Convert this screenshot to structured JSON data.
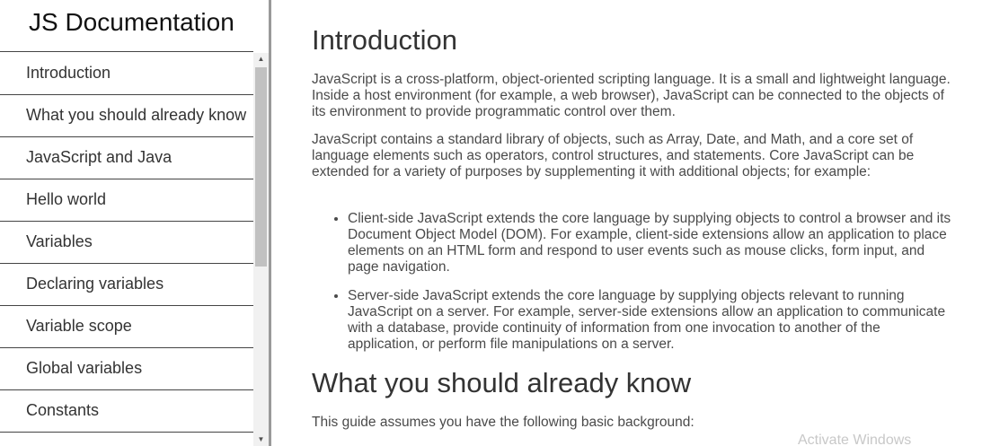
{
  "sidebar": {
    "title": "JS Documentation",
    "items": [
      {
        "label": "Introduction"
      },
      {
        "label": "What you should already know"
      },
      {
        "label": "JavaScript and Java"
      },
      {
        "label": "Hello world"
      },
      {
        "label": "Variables"
      },
      {
        "label": "Declaring variables"
      },
      {
        "label": "Variable scope"
      },
      {
        "label": "Global variables"
      },
      {
        "label": "Constants"
      }
    ]
  },
  "scrollbar": {
    "up_icon": "chevron-up-icon",
    "down_icon": "chevron-down-icon"
  },
  "main": {
    "introduction": {
      "title": "Introduction",
      "paragraphs": [
        "JavaScript is a cross-platform, object-oriented scripting language. It is a small and lightweight language. Inside a host environment (for example, a web browser), JavaScript can be connected to the objects of its environment to provide programmatic control over them.",
        "JavaScript contains a standard library of objects, such as Array, Date, and Math, and a core set of language elements such as operators, control structures, and statements. Core JavaScript can be extended for a variety of purposes by supplementing it with additional objects; for example:"
      ],
      "list": [
        "Client-side JavaScript extends the core language by supplying objects to control a browser and its Document Object Model (DOM). For example, client-side extensions allow an application to place elements on an HTML form and respond to user events such as mouse clicks, form input, and page navigation.",
        "Server-side JavaScript extends the core language by supplying objects relevant to running JavaScript on a server. For example, server-side extensions allow an application to communicate with a database, provide continuity of information from one invocation to another of the application, or perform file manipulations on a server."
      ]
    },
    "already_know": {
      "title": "What you should already know",
      "paragraphs": [
        "This guide assumes you have the following basic background:"
      ]
    }
  },
  "watermark": "Activate Windows"
}
